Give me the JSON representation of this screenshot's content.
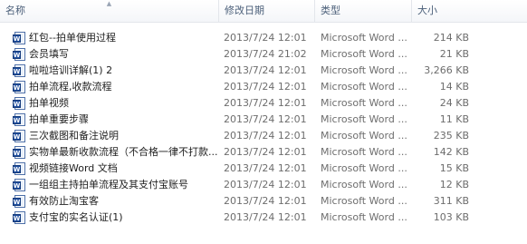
{
  "columns": {
    "name": "名称",
    "date": "修改日期",
    "type": "类型",
    "size": "大小"
  },
  "files": [
    {
      "name": "红包--拍单使用过程",
      "date": "2013/7/24 12:01",
      "type": "Microsoft Word ...",
      "size": "214 KB",
      "icon": "word-document-icon"
    },
    {
      "name": "会员填写",
      "date": "2013/7/24 21:02",
      "type": "Microsoft Word ...",
      "size": "21 KB",
      "icon": "word-document-icon"
    },
    {
      "name": "啦啦培训详解(1) 2",
      "date": "2013/7/24 12:01",
      "type": "Microsoft Word ...",
      "size": "3,266 KB",
      "icon": "word-document-icon"
    },
    {
      "name": "拍单流程,收款流程",
      "date": "2013/7/24 12:01",
      "type": "Microsoft Word ...",
      "size": "14 KB",
      "icon": "word-document-icon"
    },
    {
      "name": "拍单视频",
      "date": "2013/7/24 12:01",
      "type": "Microsoft Word ...",
      "size": "24 KB",
      "icon": "word-document-icon"
    },
    {
      "name": "拍单重要步骤",
      "date": "2013/7/24 12:01",
      "type": "Microsoft Word ...",
      "size": "11 KB",
      "icon": "word-document-icon"
    },
    {
      "name": "三次截图和备注说明",
      "date": "2013/7/24 12:01",
      "type": "Microsoft Word ...",
      "size": "235 KB",
      "icon": "word-document-icon"
    },
    {
      "name": "实物单最新收款流程（不合格一律不打款...",
      "date": "2013/7/24 12:01",
      "type": "Microsoft Word ...",
      "size": "142 KB",
      "icon": "word-document-icon"
    },
    {
      "name": "视频链接Word 文档",
      "date": "2013/7/24 12:01",
      "type": "Microsoft Word ...",
      "size": "15 KB",
      "icon": "word-document-icon"
    },
    {
      "name": "一组组主持拍单流程及其支付宝账号",
      "date": "2013/7/24 12:01",
      "type": "Microsoft Word ...",
      "size": "12 KB",
      "icon": "word-document-icon"
    },
    {
      "name": "有效防止淘宝客",
      "date": "2013/7/24 12:01",
      "type": "Microsoft Word ...",
      "size": "311 KB",
      "icon": "word-document-icon"
    },
    {
      "name": "支付宝的实名认证(1)",
      "date": "2013/7/24 12:01",
      "type": "Microsoft Word ...",
      "size": "103 KB",
      "icon": "word-document-icon"
    }
  ]
}
